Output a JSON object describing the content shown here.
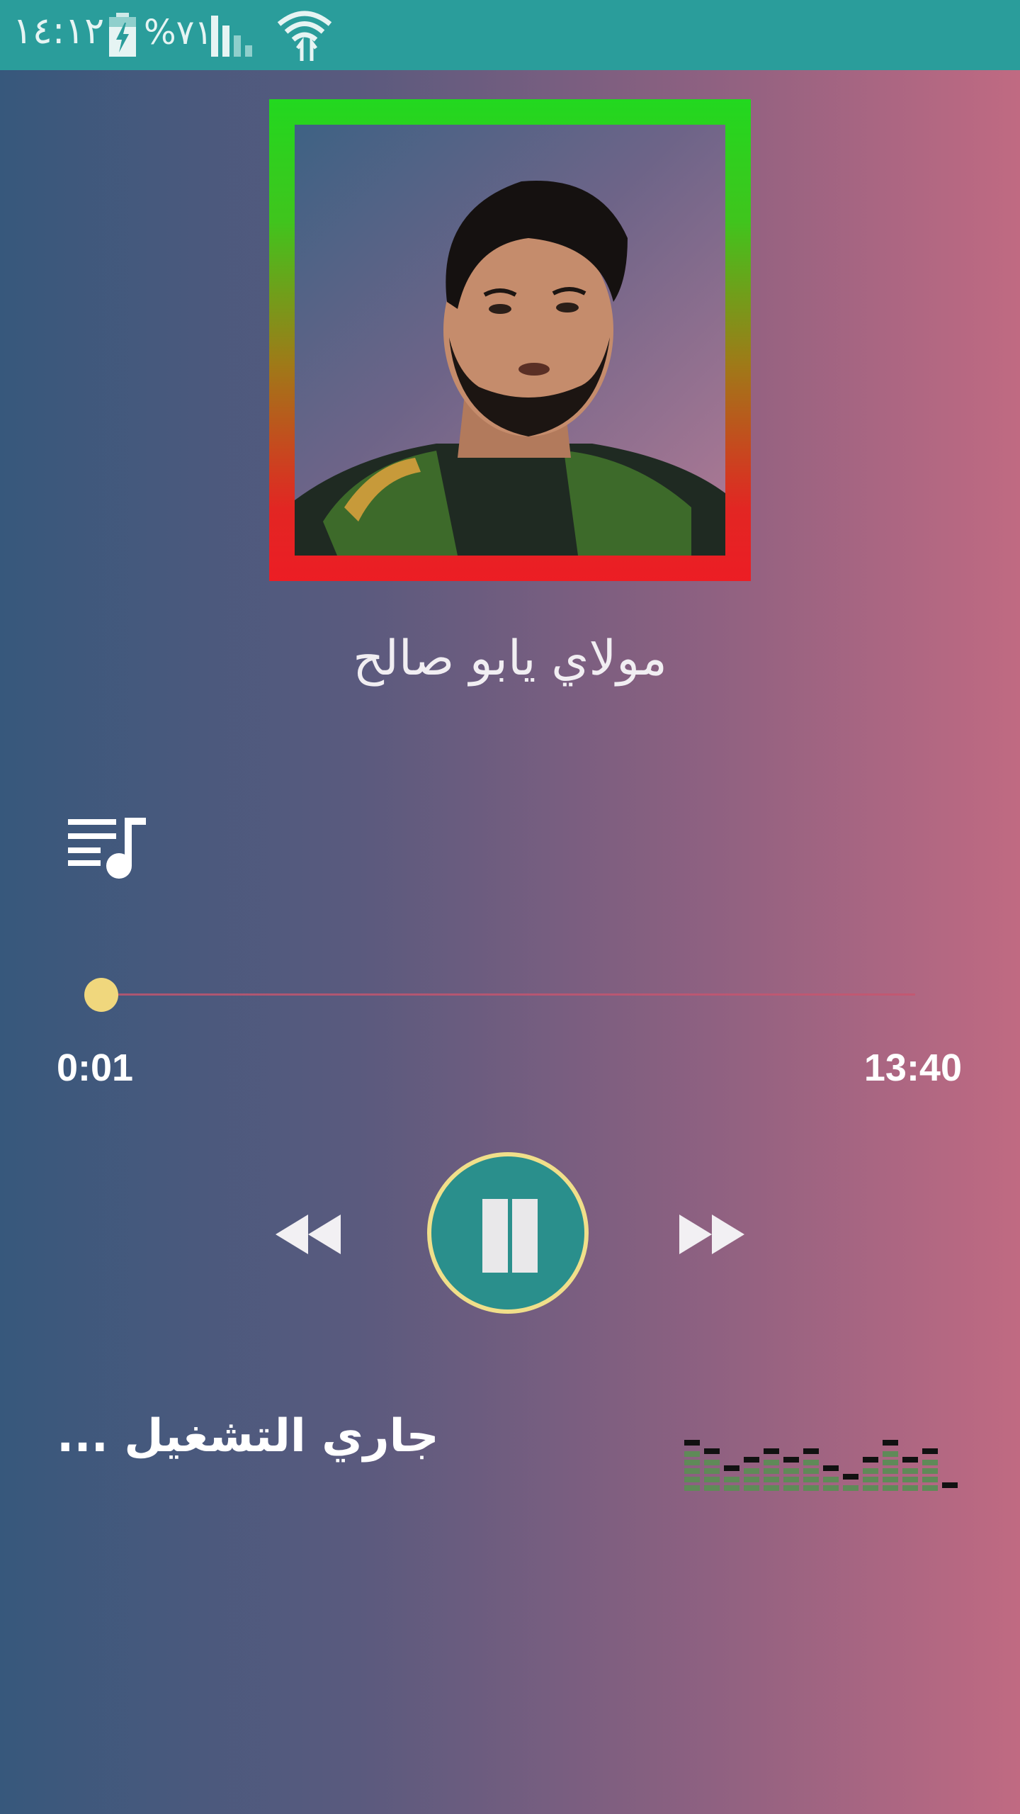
{
  "status_bar": {
    "time": "١٤:١٢",
    "battery_percent": "%٧١",
    "icons": [
      "battery-charging-icon",
      "signal-icon",
      "wifi-icon"
    ]
  },
  "player": {
    "track_title": "مولاي يابو صالح",
    "time_current": "0:01",
    "time_total": "13:40",
    "progress_fraction": 0.001,
    "now_playing": "جاري التشغيل ...",
    "controls": [
      "rewind-icon",
      "pause-icon",
      "fast-forward-icon"
    ],
    "playlist_icon": "playlist-music-icon"
  },
  "colors": {
    "status_bar": "#2a9d9b",
    "gradient_left": "#37587c",
    "gradient_right": "#c06a82",
    "frame_top": "#22d81f",
    "frame_bottom": "#ec1d24",
    "seek_thumb": "#f0d77d",
    "pause_button": "#2a8f8c",
    "pause_ring": "#f0df8a"
  }
}
